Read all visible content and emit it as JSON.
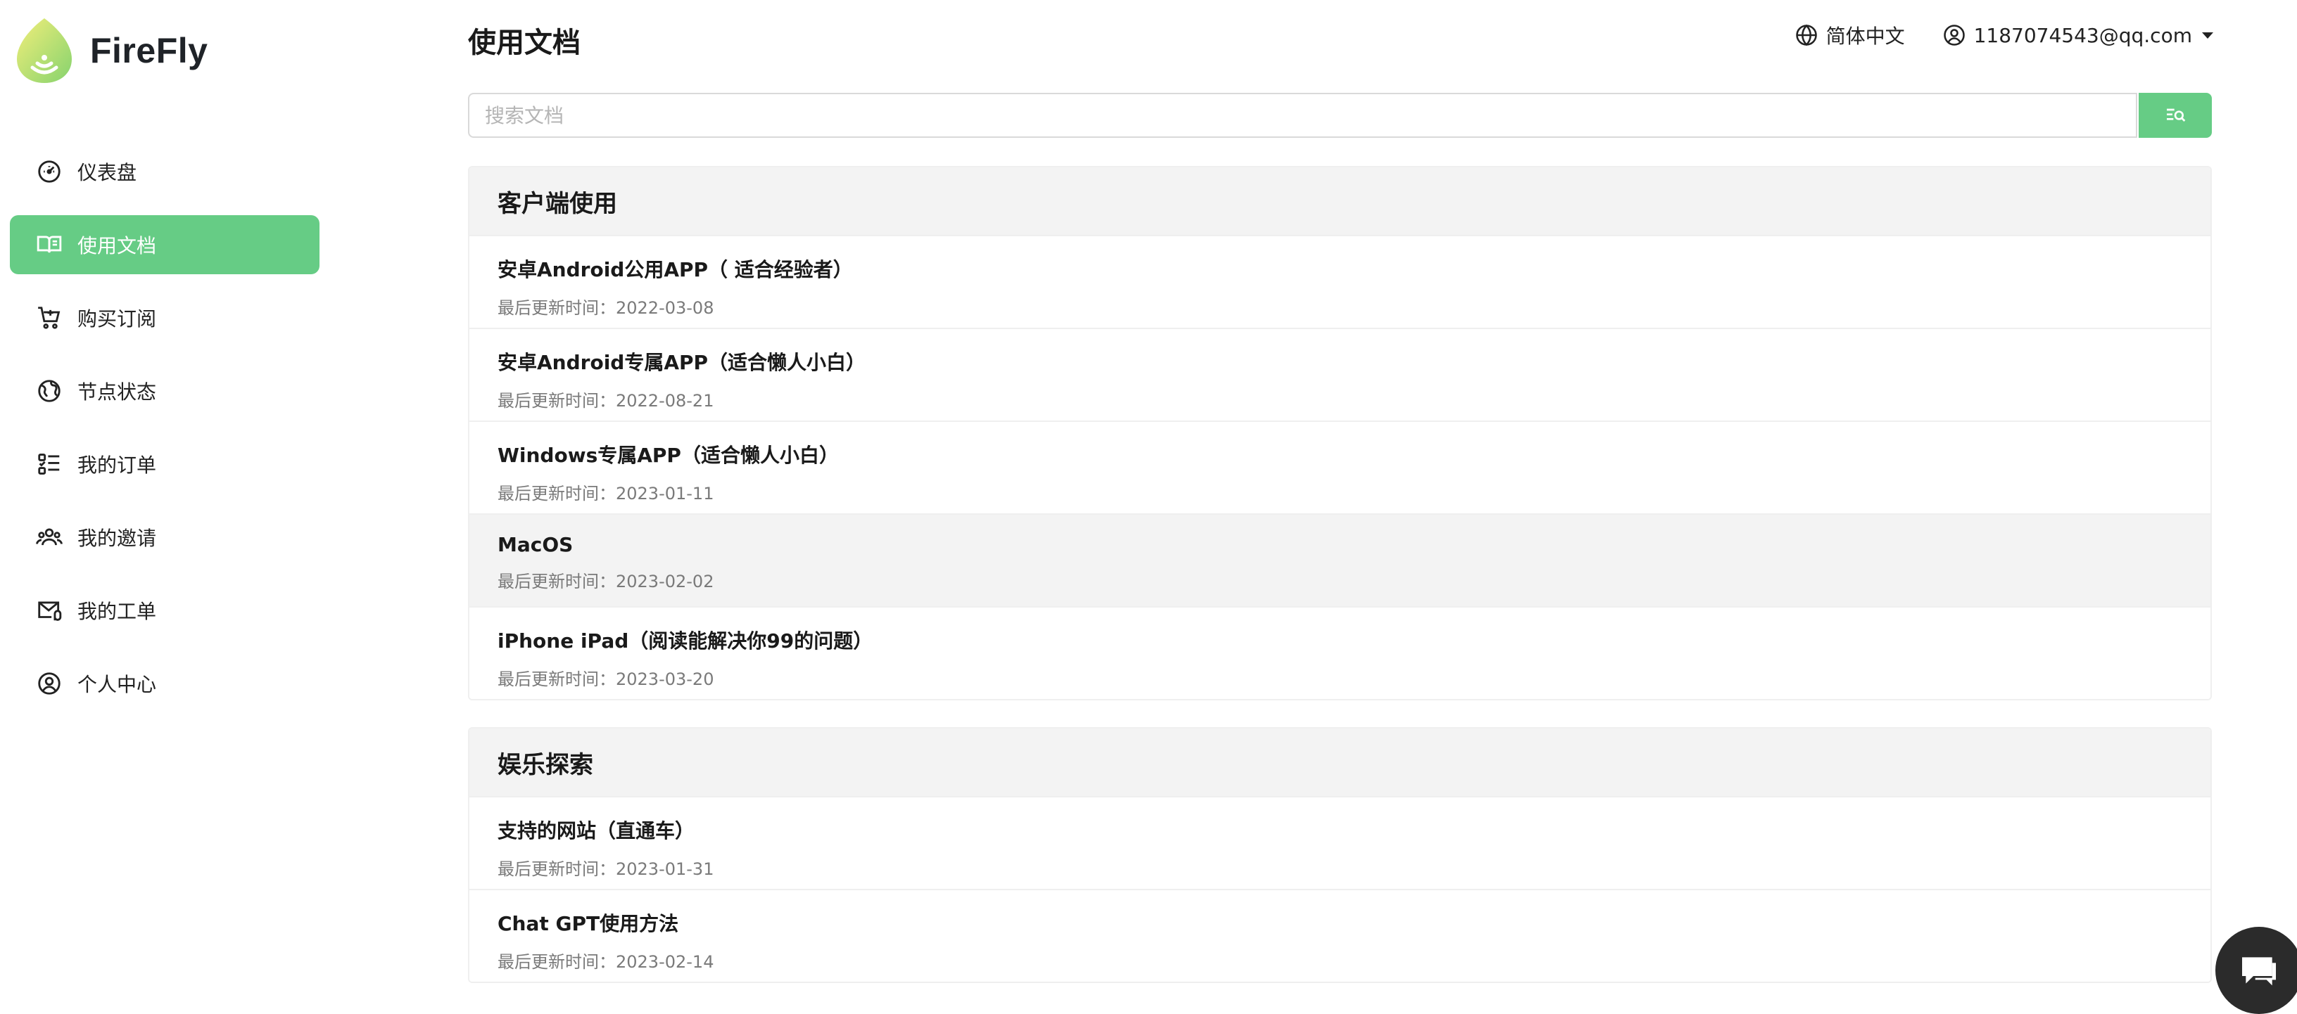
{
  "app": {
    "logo_text": "FireFly"
  },
  "sidebar": {
    "items": [
      {
        "label": "仪表盘",
        "icon": "dashboard-gauge-icon"
      },
      {
        "label": "使用文档",
        "icon": "book-icon",
        "active": true
      },
      {
        "label": "购买订阅",
        "icon": "shopping-cart-icon"
      },
      {
        "label": "节点状态",
        "icon": "globe-icon"
      },
      {
        "label": "我的订单",
        "icon": "order-list-icon"
      },
      {
        "label": "我的邀请",
        "icon": "users-icon"
      },
      {
        "label": "我的工单",
        "icon": "ticket-mail-icon"
      },
      {
        "label": "个人中心",
        "icon": "user-circle-icon"
      }
    ]
  },
  "header": {
    "title": "使用文档",
    "language": "简体中文",
    "user_email": "1187074543@qq.com"
  },
  "search": {
    "placeholder": "搜索文档",
    "value": ""
  },
  "sections": [
    {
      "title": "客户端使用",
      "docs": [
        {
          "title": "安卓Android公用APP（ 适合经验者）",
          "date": "最后更新时间：2022-03-08"
        },
        {
          "title": "安卓Android专属APP（适合懒人小白）",
          "date": "最后更新时间：2022-08-21"
        },
        {
          "title": "Windows专属APP（适合懒人小白）",
          "date": "最后更新时间：2023-01-11"
        },
        {
          "title": "MacOS",
          "date": "最后更新时间：2023-02-02"
        },
        {
          "title": "iPhone iPad（阅读能解决你99的问题）",
          "date": "最后更新时间：2023-03-20"
        }
      ]
    },
    {
      "title": "娱乐探索",
      "docs": [
        {
          "title": "支持的网站（直通车）",
          "date": "最后更新时间：2023-01-31"
        },
        {
          "title": "Chat GPT使用方法",
          "date": "最后更新时间：2023-02-14"
        }
      ]
    }
  ],
  "colors": {
    "accent": "#66cc85",
    "section_bg": "#f3f3f3",
    "chat_button": "#2b2b2b"
  }
}
